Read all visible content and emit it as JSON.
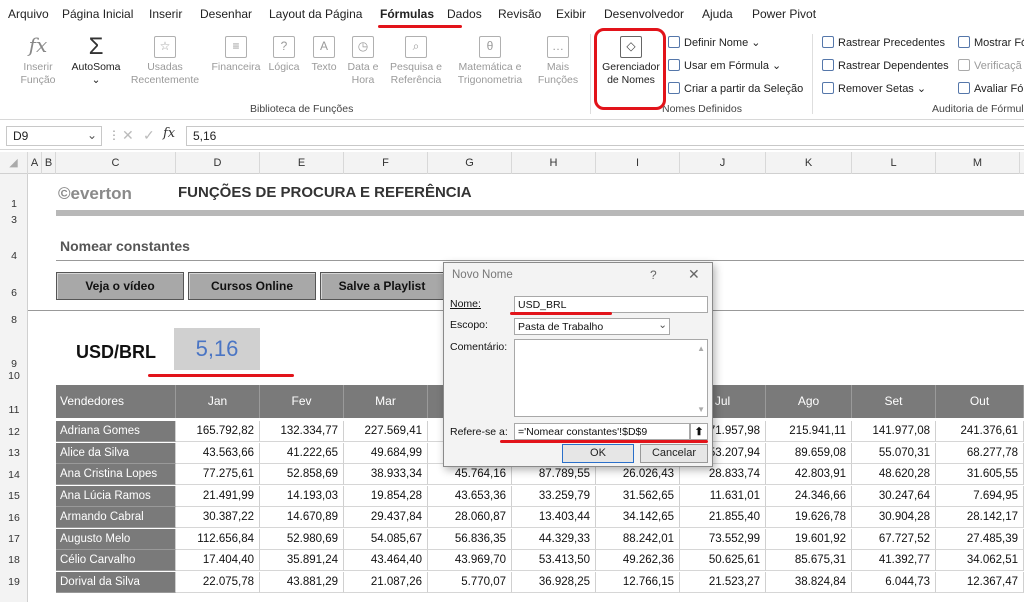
{
  "menu": [
    "Arquivo",
    "Página Inicial",
    "Inserir",
    "Desenhar",
    "Layout da Página",
    "Fórmulas",
    "Dados",
    "Revisão",
    "Exibir",
    "Desenvolvedor",
    "Ajuda",
    "Power Pivot"
  ],
  "ribbon": {
    "library": {
      "insert_function_1": "Inserir",
      "insert_function_2": "Função",
      "autosum": "AutoSoma",
      "recent_1": "Usadas",
      "recent_2": "Recentemente",
      "financial": "Financeira",
      "logical": "Lógica",
      "text": "Texto",
      "date_1": "Data e",
      "date_2": "Hora",
      "lookup_1": "Pesquisa e",
      "lookup_2": "Referência",
      "math_1": "Matemática e",
      "math_2": "Trigonometria",
      "more_1": "Mais",
      "more_2": "Funções",
      "group_label": "Biblioteca de Funções"
    },
    "names": {
      "manager_1": "Gerenciador",
      "manager_2": "de Nomes",
      "define": "Definir Nome",
      "use_in_formula": "Usar em Fórmula",
      "create_from_selection": "Criar a partir da Seleção",
      "group_label": "Nomes Definidos"
    },
    "audit": {
      "trace_precedents": "Rastrear Precedentes",
      "trace_dependents": "Rastrear Dependentes",
      "remove_arrows": "Remover Setas",
      "show_formulas": "Mostrar Fó",
      "error_check": "Verificaçã",
      "evaluate": "Avaliar Fó",
      "group_label": "Auditoria de Fórmul"
    }
  },
  "formula_bar": {
    "name_box": "D9",
    "fx": "fx",
    "value": "5,16"
  },
  "columns": [
    "A",
    "B",
    "C",
    "D",
    "E",
    "F",
    "G",
    "H",
    "I",
    "J",
    "K",
    "L",
    "M"
  ],
  "rows": [
    "1",
    "3",
    "4",
    "6",
    "8",
    "9",
    "10",
    "11",
    "12",
    "13",
    "14",
    "15",
    "16",
    "17",
    "18",
    "19"
  ],
  "sheet": {
    "logo": "©everton",
    "title": "FUNÇÕES DE PROCURA E REFERÊNCIA",
    "section": "Nomear constantes",
    "buttons": [
      "Veja o vídeo",
      "Cursos Online",
      "Salve a Playlist"
    ],
    "usd_label": "USD/BRL",
    "usd_value": "5,16"
  },
  "table": {
    "headers": [
      "Vendedores",
      "Jan",
      "Fev",
      "Mar",
      "Abr",
      "Mai",
      "Jun",
      "Jul",
      "Ago",
      "Set",
      "Out"
    ],
    "rows": [
      {
        "name": "Adriana Gomes",
        "values": [
          "165.792,82",
          "132.334,77",
          "227.569,41",
          "",
          "",
          "",
          "71.957,98",
          "215.941,11",
          "141.977,08",
          "241.376,61"
        ]
      },
      {
        "name": "Alice da Silva",
        "values": [
          "43.563,66",
          "41.222,65",
          "49.684,99",
          "",
          "",
          "",
          "53.207,94",
          "89.659,08",
          "55.070,31",
          "68.277,78"
        ]
      },
      {
        "name": "Ana Cristina Lopes",
        "values": [
          "77.275,61",
          "52.858,69",
          "38.933,34",
          "45.764,16",
          "87.789,55",
          "26.026,43",
          "28.833,74",
          "42.803,91",
          "48.620,28",
          "31.605,55"
        ]
      },
      {
        "name": "Ana Lúcia Ramos",
        "values": [
          "21.491,99",
          "14.193,03",
          "19.854,28",
          "43.653,36",
          "33.259,79",
          "31.562,65",
          "11.631,01",
          "24.346,66",
          "30.247,64",
          "7.694,95"
        ]
      },
      {
        "name": "Armando Cabral",
        "values": [
          "30.387,22",
          "14.670,89",
          "29.437,84",
          "28.060,87",
          "13.403,44",
          "34.142,65",
          "21.855,40",
          "19.626,78",
          "30.904,28",
          "28.142,17"
        ]
      },
      {
        "name": "Augusto Melo",
        "values": [
          "112.656,84",
          "52.980,69",
          "54.085,67",
          "56.836,35",
          "44.329,33",
          "88.242,01",
          "73.552,99",
          "19.601,92",
          "67.727,52",
          "27.485,39"
        ]
      },
      {
        "name": "Célio Carvalho",
        "values": [
          "17.404,40",
          "35.891,24",
          "43.464,40",
          "43.969,70",
          "53.413,50",
          "49.262,36",
          "50.625,61",
          "85.675,31",
          "41.392,77",
          "34.062,51"
        ]
      },
      {
        "name": "Dorival da Silva",
        "values": [
          "22.075,78",
          "43.881,29",
          "21.087,26",
          "5.770,07",
          "36.928,25",
          "12.766,15",
          "21.523,27",
          "38.824,84",
          "6.044,73",
          "12.367,47"
        ]
      }
    ]
  },
  "dialog": {
    "title": "Novo Nome",
    "help": "?",
    "close": "✕",
    "name_label": "Nome:",
    "name_value": "USD_BRL",
    "scope_label": "Escopo:",
    "scope_value": "Pasta de Trabalho",
    "comment_label": "Comentário:",
    "refers_label": "Refere-se a:",
    "refers_value": "='Nomear constantes'!$D$9",
    "ok": "OK",
    "cancel": "Cancelar"
  },
  "colors": {
    "accent_red": "#e2131a",
    "header_gray": "#7a7a7a",
    "value_blue": "#4a75c4"
  }
}
